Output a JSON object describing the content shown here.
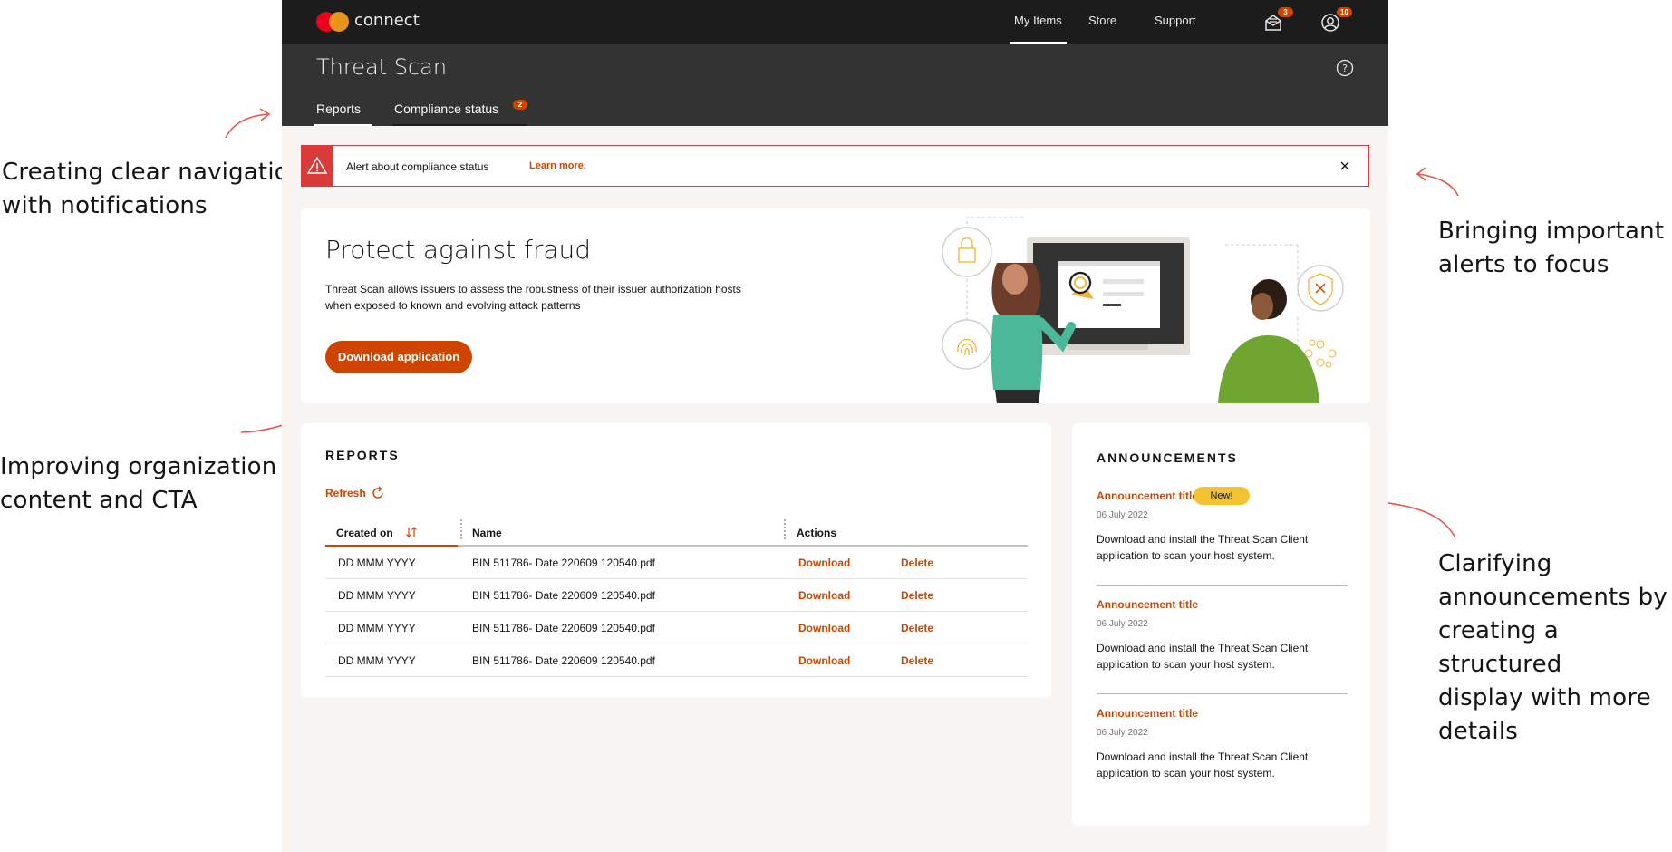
{
  "annotations": {
    "nav_line1": "Creating clear navigation",
    "nav_line2": "with notifications",
    "alerts_line1": "Bringing important",
    "alerts_line2": "alerts to focus",
    "content_line1": "Improving organization of",
    "content_line2": "content and CTA",
    "ann_line1": "Clarifying",
    "ann_line2": "announcements by",
    "ann_line3": "creating a structured",
    "ann_line4": "display with more",
    "ann_line5": "details"
  },
  "colors": {
    "accent": "#cf4500",
    "alert": "#d93a3a",
    "nav_bg": "#1c1c1c",
    "subhead_bg": "#333333",
    "page_bg": "#f8f4f1",
    "badge_new": "#f4c430"
  },
  "topnav": {
    "brand": "connect",
    "links": [
      "My Items",
      "Store",
      "Support"
    ],
    "active": "My Items",
    "messages_count": "3",
    "profile_count": "10"
  },
  "header": {
    "title": "Threat Scan",
    "tabs": [
      {
        "label": "Reports",
        "active": true
      },
      {
        "label": "Compliance status",
        "badge": "2"
      }
    ]
  },
  "alert": {
    "text": "Alert about compliance status",
    "link": "Learn more."
  },
  "hero": {
    "title": "Protect against fraud",
    "description": "Threat Scan allows issuers to assess the robustness of their issuer authorization hosts when exposed to known and evolving attack patterns",
    "button": "Download application"
  },
  "reports": {
    "title": "REPORTS",
    "refresh": "Refresh",
    "columns": [
      "Created on",
      "Name",
      "Actions"
    ],
    "rows": [
      {
        "date": "DD MMM YYYY",
        "name": "BIN 511786- Date 220609 120540.pdf",
        "download": "Download",
        "delete": "Delete"
      },
      {
        "date": "DD MMM YYYY",
        "name": "BIN 511786- Date 220609 120540.pdf",
        "download": "Download",
        "delete": "Delete"
      },
      {
        "date": "DD MMM YYYY",
        "name": "BIN 511786- Date 220609 120540.pdf",
        "download": "Download",
        "delete": "Delete"
      },
      {
        "date": "DD MMM YYYY",
        "name": "BIN 511786- Date 220609 120540.pdf",
        "download": "Download",
        "delete": "Delete"
      }
    ]
  },
  "announcements": {
    "title": "ANNOUNCEMENTS",
    "new_badge": "New!",
    "items": [
      {
        "title": "Announcement title",
        "date": "06 July 2022",
        "body": "Download and install the Threat Scan Client application to scan your host system."
      },
      {
        "title": "Announcement title",
        "date": "06 July 2022",
        "body": "Download and install the Threat Scan Client application to scan your host system."
      },
      {
        "title": "Announcement title",
        "date": "06 July 2022",
        "body": "Download and install the Threat Scan Client application to scan your host system."
      }
    ]
  }
}
